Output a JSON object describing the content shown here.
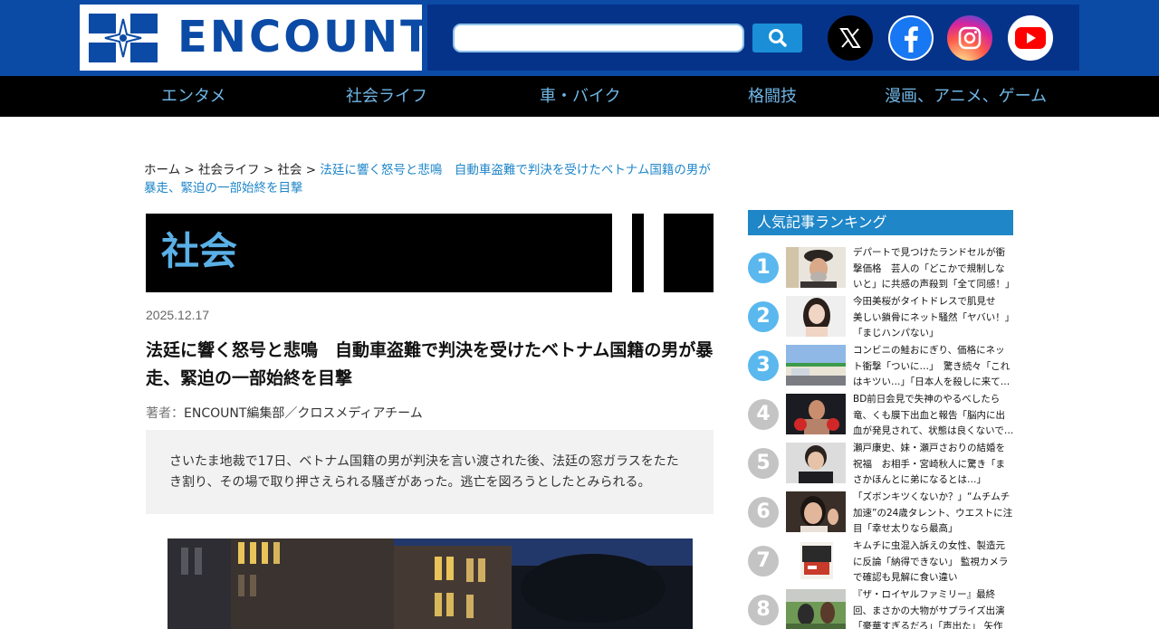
{
  "header": {
    "logo_text": "ENCOUNT",
    "search": {
      "placeholder": "",
      "value": ""
    },
    "social": [
      {
        "name": "x-icon"
      },
      {
        "name": "facebook-icon"
      },
      {
        "name": "instagram-icon"
      },
      {
        "name": "youtube-icon"
      }
    ]
  },
  "nav": {
    "items": [
      "エンタメ",
      "社会ライフ",
      "車・バイク",
      "格闘技",
      "漫画、アニメ、ゲーム"
    ]
  },
  "breadcrumb": {
    "items": [
      "ホーム",
      "社会ライフ",
      "社会"
    ],
    "separator": ">",
    "current": "法廷に響く怒号と悲鳴　自動車盗難で判決を受けたベトナム国籍の男が暴走、緊迫の一部始終を目撃"
  },
  "article": {
    "category": "社会",
    "date": "2025.12.17",
    "title": "法廷に響く怒号と悲鳴　自動車盗難で判決を受けたベトナム国籍の男が暴走、緊迫の一部始終を目撃",
    "author_prefix": "著者：",
    "author": "ENCOUNT編集部／クロスメディアチーム",
    "summary": "さいたま地裁で17日、ベトナム国籍の男が判決を言い渡された後、法廷の窓ガラスをたたき割り、その場で取り押さえられる騒ぎがあった。逃亡を図ろうとしたとみられる。"
  },
  "sidebar": {
    "ranking_title": "人気記事ランキング",
    "items": [
      {
        "rank": "1",
        "text": "デパートで見つけたランドセルが衝撃価格　芸人の「どこかで規制しないと」に共感の声殺到「全て同感！」"
      },
      {
        "rank": "2",
        "text": "今田美桜がタイトドレスで肌見せ　美しい鎖骨にネット騒然「ヤバい！」「まじハンパない」"
      },
      {
        "rank": "3",
        "text": "コンビニの鮭おにぎり、価格にネット衝撃「ついに…」　驚き続々「これはキツい…」「日本人を殺しに来て…"
      },
      {
        "rank": "4",
        "text": "BD前日会見で失神のやるべしたら竜、くも膜下出血と報告「脳内に出血が発見されて、状態は良くないで…"
      },
      {
        "rank": "5",
        "text": "瀬戸康史、妹・瀬戸さおりの結婚を祝福　お相手・宮崎秋人に驚き「まさかほんとに弟になるとは…」"
      },
      {
        "rank": "6",
        "text": "「ズボンキツくないか？」“ムチムチ加速”の24歳タレント、ウエストに注目「幸せ太りなら最高」"
      },
      {
        "rank": "7",
        "text": "キムチに虫混入訴えの女性、製造元に反論「納得できない」 監視カメラで確認も見解に食い違い"
      },
      {
        "rank": "8",
        "text": "『ザ・ロイヤルファミリー』最終回、まさかの大物がサプライズ出演「豪華すぎるだろ」「声出た」 矢作師…"
      }
    ]
  },
  "colors": {
    "header_blue": "#0b4ba6",
    "header_dark_blue": "#06338a",
    "nav_bg": "#000000",
    "nav_text": "#6fb6e6",
    "accent": "#1f86c8",
    "rank_top": "#5ab8ee",
    "rank_other": "#c4c4c4"
  }
}
